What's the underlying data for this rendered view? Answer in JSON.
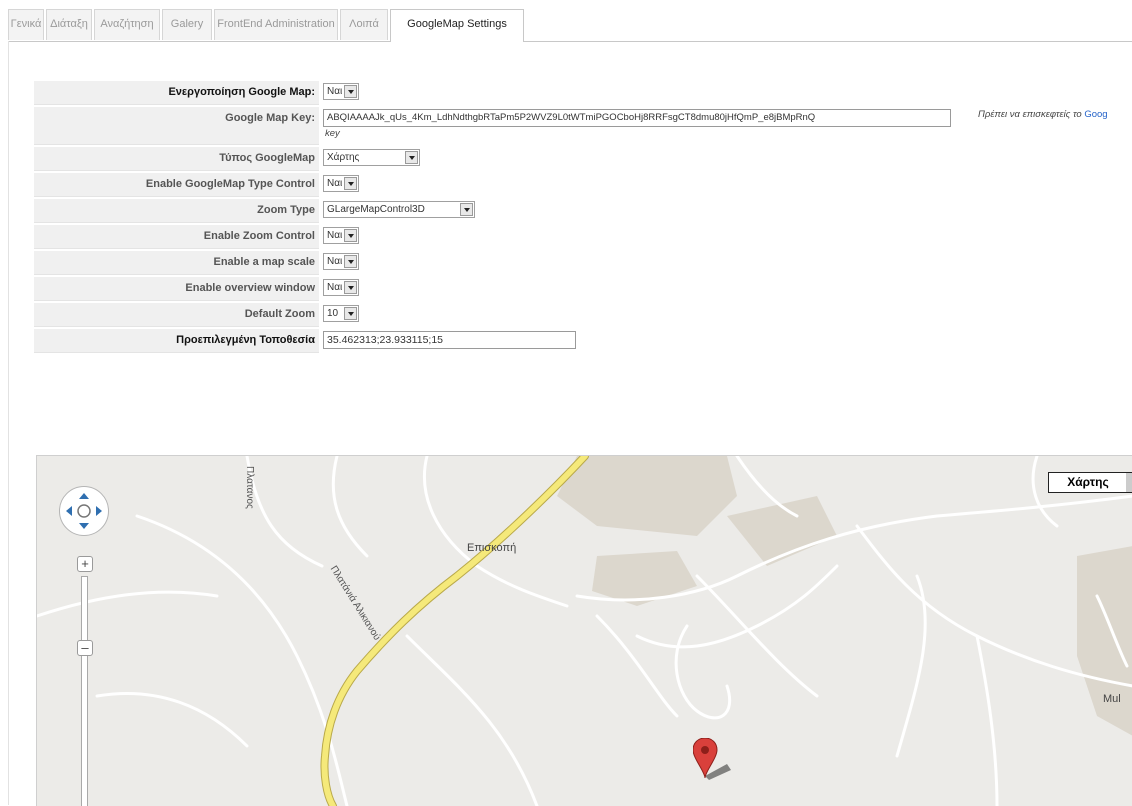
{
  "tabs": [
    {
      "label": "Γενικά",
      "active": false
    },
    {
      "label": "Διάταξη",
      "active": false
    },
    {
      "label": "Αναζήτηση",
      "active": false
    },
    {
      "label": "Galery",
      "active": false
    },
    {
      "label": "FrontEnd Administration",
      "active": false
    },
    {
      "label": "Λοιπά",
      "active": false
    },
    {
      "label": "GoogleMap Settings",
      "active": true
    }
  ],
  "settings": {
    "enable_map": {
      "label": "Ενεργοποίηση Google Map:",
      "value": "Ναι"
    },
    "map_key": {
      "label": "Google Map Key:",
      "value": "ABQIAAAAJk_qUs_4Km_LdhNdthgbRTaPm5P2WVZ9L0tWTmiPGOCboHj8RRFsgCT8dmu80jHfQmP_e8jBMpRnQ",
      "hint": "Πρέπει να επισκεφτείς το",
      "hint_link": "Goog",
      "hint_tail": "key"
    },
    "map_type": {
      "label": "Τύπος GoogleMap",
      "value": "Χάρτης"
    },
    "type_control": {
      "label": "Enable GoogleMap Type Control",
      "value": "Ναι"
    },
    "zoom_type": {
      "label": "Zoom Type",
      "value": "GLargeMapControl3D"
    },
    "zoom_control": {
      "label": "Enable Zoom Control",
      "value": "Ναι"
    },
    "map_scale": {
      "label": "Enable a map scale",
      "value": "Ναι"
    },
    "overview": {
      "label": "Enable overview window",
      "value": "Ναι"
    },
    "default_zoom": {
      "label": "Default Zoom",
      "value": "10"
    },
    "default_location": {
      "label": "Προεπιλεγμένη Τοποθεσία",
      "value": "35.462313;23.933115;15"
    }
  },
  "map": {
    "type_button": "Χάρτης",
    "labels": {
      "road_top": "Πλατανος",
      "road_diag": "Πλατάνιά Αλικιανού",
      "village": "Επισκοπή",
      "right_edge": "Mul"
    },
    "colors": {
      "main_road": "#f5e97a",
      "land": "#ecebe8",
      "area": "#dcd7cd",
      "marker": "#d9403b"
    }
  }
}
